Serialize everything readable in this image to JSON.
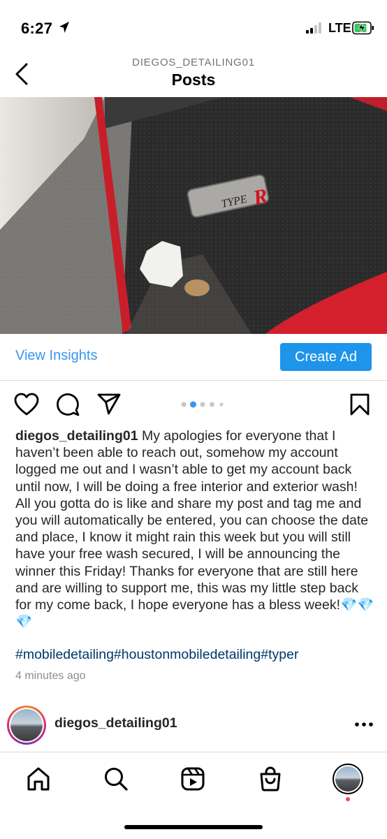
{
  "status_bar": {
    "time": "6:27",
    "network": "LTE",
    "icons": [
      "location-arrow-icon",
      "signal-icon",
      "battery-charging-icon"
    ]
  },
  "header": {
    "username": "DIEGOS_DETAILING01",
    "title": "Posts",
    "back_icon": "chevron-left-icon"
  },
  "post": {
    "image_description": "Car floor mat with TYPE R logo",
    "logo_text": "TYPE",
    "logo_r": "R",
    "view_insights": "View Insights",
    "create_ad": "Create Ad",
    "carousel": {
      "count": 5,
      "active": 1
    },
    "action_icons": [
      "heart-icon",
      "comment-icon",
      "share-icon",
      "bookmark-icon"
    ],
    "caption_user": "diegos_detailing01",
    "caption_text": " My apologies for everyone that I haven’t been able to reach out, somehow my account logged me out and I wasn’t able to get my account back until now, I will be doing a free interior and exterior wash! All you gotta do is like and share my post and tag me and you will automatically be entered, you can choose the date and place, I know it might rain this week but you will still have your free wash secured, I will be announcing the winner this Friday! Thanks for everyone that are still here and are willing to support me, this was my little step back for my come back, I hope everyone has a bless week!💎💎💎",
    "hashtags": "#mobiledetailing#houstonmobiledetailing#typer",
    "time_ago": "4 minutes ago"
  },
  "next_post": {
    "username": "diegos_detailing01"
  },
  "tab_bar": {
    "tabs": [
      "home-icon",
      "search-icon",
      "reels-icon",
      "shop-icon",
      "profile-avatar"
    ]
  },
  "colors": {
    "link_blue": "#3897f0",
    "button_blue": "#1e94ea",
    "hashtag_blue": "#00376b",
    "text": "#262626",
    "muted": "#8e8e8e",
    "notification_dot": "#ed4956"
  }
}
